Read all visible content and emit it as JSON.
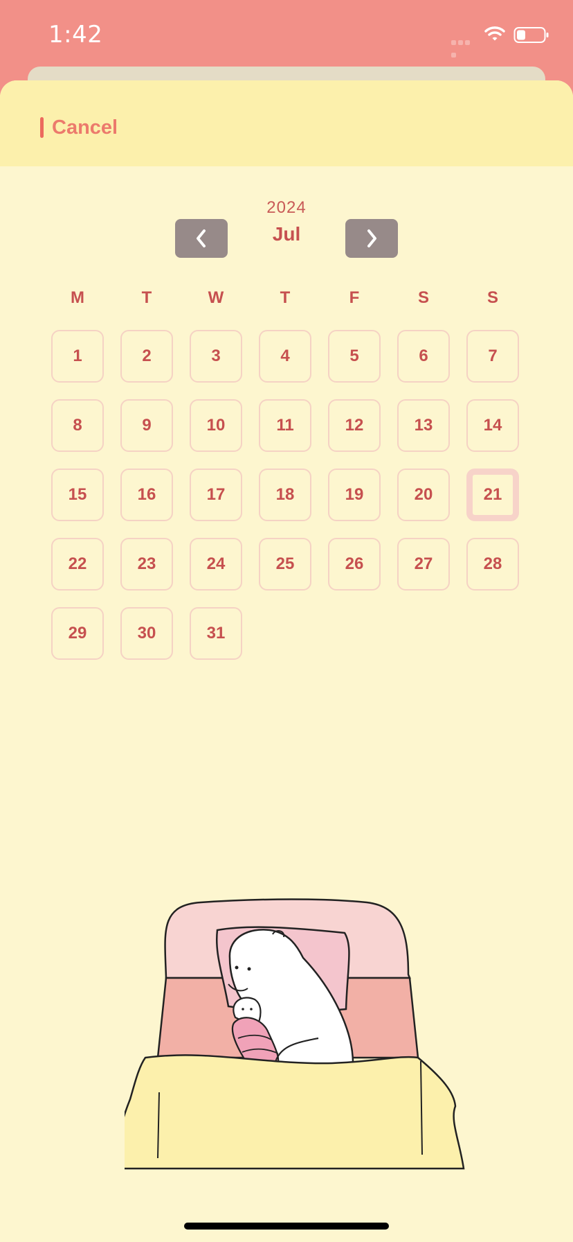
{
  "status_bar": {
    "time": "1:42"
  },
  "header": {
    "cancel_label": "Cancel"
  },
  "calendar": {
    "year": "2024",
    "month": "Jul",
    "weekdays": [
      "M",
      "T",
      "W",
      "T",
      "F",
      "S",
      "S"
    ],
    "days": [
      "1",
      "2",
      "3",
      "4",
      "5",
      "6",
      "7",
      "8",
      "9",
      "10",
      "11",
      "12",
      "13",
      "14",
      "15",
      "16",
      "17",
      "18",
      "19",
      "20",
      "21",
      "22",
      "23",
      "24",
      "25",
      "26",
      "27",
      "28",
      "29",
      "30",
      "31"
    ],
    "selected_day": "21"
  },
  "colors": {
    "status_background": "#f29088",
    "sheet_background": "#fdf6cf",
    "header_background": "#fcf0ac",
    "accent_text": "#c6504f",
    "nav_button": "#978a89",
    "day_border": "#f5d2c4"
  },
  "icons": {
    "prev": "chevron-left-icon",
    "next": "chevron-right-icon",
    "wifi": "wifi-icon",
    "battery": "battery-icon",
    "signal": "cellular-signal-icon"
  }
}
